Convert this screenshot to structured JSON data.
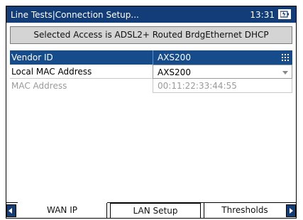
{
  "titlebar": {
    "title": "Line Tests|Connection Setup...",
    "time": "13:31",
    "battery_icon": "battery-charging-icon"
  },
  "banner": {
    "text": "Selected Access  is ADSL2+ Routed BrdgEthernet DHCP"
  },
  "fields": {
    "vendor_id": {
      "label": "Vendor ID",
      "value": "AXS200",
      "icon": "keypad-grid-icon"
    },
    "local_mac": {
      "label": "Local MAC Address",
      "value": "AXS200",
      "icon": "dropdown-caret-icon"
    },
    "mac_address": {
      "label": "MAC Address",
      "value": "00:11:22:33:44:55"
    }
  },
  "tabs": [
    {
      "label": "WAN IP"
    },
    {
      "label": "LAN Setup"
    },
    {
      "label": "Thresholds"
    }
  ],
  "colors": {
    "titlebar": "#123d78",
    "selected_row": "#164b8c",
    "banner": "#d4d4d4"
  }
}
